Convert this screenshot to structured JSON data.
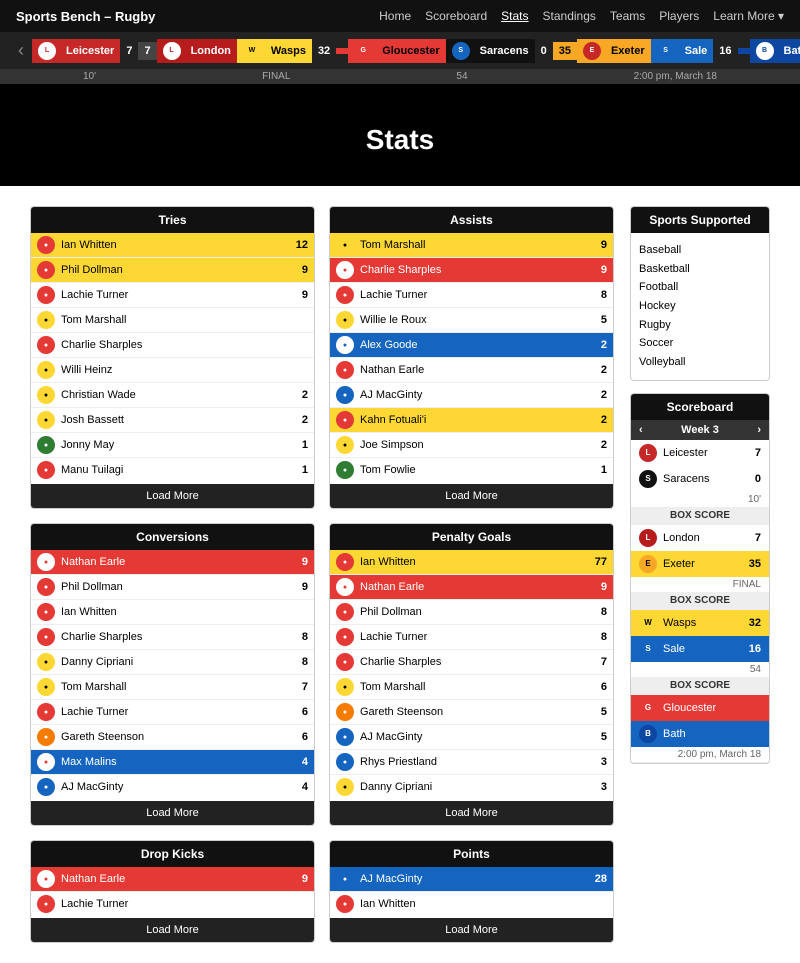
{
  "nav": {
    "title": "Sports Bench – Rugby",
    "links": [
      "Home",
      "Scoreboard",
      "Stats",
      "Standings",
      "Teams",
      "Players",
      "Learn More ▾"
    ]
  },
  "scorebar": {
    "matches": [
      {
        "home": "Leicester",
        "home_score": 7,
        "away": "London",
        "away_score": 7
      },
      {
        "home": "Wasps",
        "home_score": 32,
        "away": "Gloucester",
        "away_score": ""
      },
      {
        "home": "Saracens",
        "home_score": 0,
        "away": "Exeter",
        "away_score": 35
      },
      {
        "home": "Sale",
        "home_score": 16,
        "away": "Bath",
        "away_score": ""
      }
    ],
    "times": [
      "10'",
      "FINAL",
      "54",
      "2:00 pm, March 18"
    ]
  },
  "hero": {
    "title": "Stats"
  },
  "sports_supported": {
    "title": "Sports Supported",
    "sports": [
      "Baseball",
      "Basketball",
      "Football",
      "Hockey",
      "Rugby",
      "Soccer",
      "Volleyball"
    ]
  },
  "scoreboard": {
    "title": "Scoreboard",
    "week": "Week 3",
    "matches": [
      {
        "home": "Leicester",
        "home_score": 7,
        "home_color": "leicester-red",
        "away": "Saracens",
        "away_score": 0,
        "away_color": "saracens-black",
        "time": "10'",
        "box_score": "BOX SCORE"
      },
      {
        "home": "London",
        "home_score": 7,
        "home_color": "london-red2",
        "away": "Exeter",
        "away_score": 35,
        "away_color": "exeter-yellow",
        "time": "FINAL",
        "box_score": "BOX SCORE"
      },
      {
        "home": "Wasps",
        "home_score": 32,
        "home_color": "wasps-yellow",
        "away": "Sale",
        "away_score": 16,
        "away_color": "sale-blue",
        "time": "54",
        "box_score": "BOX SCORE"
      },
      {
        "home": "Gloucester",
        "home_score": "",
        "home_color": "gloucester-red",
        "away": "Bath",
        "away_score": "",
        "away_color": "bath-blue2",
        "time": "2:00 pm, March 18",
        "box_score": ""
      }
    ]
  },
  "tries": {
    "title": "Tries",
    "rows": [
      {
        "name": "Ian Whitten",
        "val": 12,
        "color": "badge-red",
        "bg": "highlight-yellow"
      },
      {
        "name": "Phil Dollman",
        "val": 9,
        "color": "badge-red",
        "bg": "highlight-yellow"
      },
      {
        "name": "Lachie Turner",
        "val": 9,
        "color": "badge-red",
        "bg": ""
      },
      {
        "name": "Tom Marshall",
        "val": "",
        "color": "badge-yellow",
        "bg": ""
      },
      {
        "name": "Charlie Sharples",
        "val": "",
        "color": "badge-red",
        "bg": ""
      },
      {
        "name": "Willi Heinz",
        "val": "",
        "color": "badge-yellow",
        "bg": ""
      },
      {
        "name": "Christian Wade",
        "val": 2,
        "color": "badge-yellow",
        "bg": ""
      },
      {
        "name": "Josh Bassett",
        "val": 2,
        "color": "badge-yellow",
        "bg": ""
      },
      {
        "name": "Jonny May",
        "val": 1,
        "color": "badge-green",
        "bg": ""
      },
      {
        "name": "Manu Tuilagi",
        "val": 1,
        "color": "badge-red",
        "bg": ""
      }
    ],
    "load_more": "Load More"
  },
  "assists": {
    "title": "Assists",
    "rows": [
      {
        "name": "Tom Marshall",
        "val": 9,
        "color": "badge-yellow",
        "bg": "highlight-yellow"
      },
      {
        "name": "Charlie Sharples",
        "val": 9,
        "color": "badge-red",
        "bg": "highlight-red"
      },
      {
        "name": "Lachie Turner",
        "val": 8,
        "color": "badge-red",
        "bg": ""
      },
      {
        "name": "Willie le Roux",
        "val": 5,
        "color": "badge-yellow",
        "bg": ""
      },
      {
        "name": "Alex Goode",
        "val": 2,
        "color": "badge-black",
        "bg": "highlight-blue"
      },
      {
        "name": "Nathan Earle",
        "val": 2,
        "color": "badge-red",
        "bg": ""
      },
      {
        "name": "AJ MacGinty",
        "val": 2,
        "color": "badge-blue",
        "bg": ""
      },
      {
        "name": "Kahn Fotuali'i",
        "val": 2,
        "color": "badge-red",
        "bg": "highlight-yellow"
      },
      {
        "name": "Joe Simpson",
        "val": 2,
        "color": "badge-yellow",
        "bg": ""
      },
      {
        "name": "Tom Fowlie",
        "val": 1,
        "color": "badge-green",
        "bg": ""
      }
    ],
    "load_more": "Load More"
  },
  "conversions": {
    "title": "Conversions",
    "rows": [
      {
        "name": "Nathan Earle",
        "val": 9,
        "color": "badge-red",
        "bg": "highlight-red"
      },
      {
        "name": "Phil Dollman",
        "val": 9,
        "color": "badge-red",
        "bg": ""
      },
      {
        "name": "Ian Whitten",
        "val": "",
        "color": "badge-red",
        "bg": ""
      },
      {
        "name": "Charlie Sharples",
        "val": 8,
        "color": "badge-red",
        "bg": ""
      },
      {
        "name": "Danny Cipriani",
        "val": 8,
        "color": "badge-yellow",
        "bg": ""
      },
      {
        "name": "Tom Marshall",
        "val": 7,
        "color": "badge-yellow",
        "bg": ""
      },
      {
        "name": "Lachie Turner",
        "val": 6,
        "color": "badge-red",
        "bg": ""
      },
      {
        "name": "Gareth Steenson",
        "val": 6,
        "color": "badge-orange",
        "bg": ""
      },
      {
        "name": "Max Malins",
        "val": 4,
        "color": "badge-red",
        "bg": "highlight-blue"
      },
      {
        "name": "AJ MacGinty",
        "val": 4,
        "color": "badge-blue",
        "bg": ""
      }
    ],
    "load_more": "Load More"
  },
  "penalty_goals": {
    "title": "Penalty Goals",
    "rows": [
      {
        "name": "Ian Whitten",
        "val": 77,
        "color": "badge-red",
        "bg": "highlight-yellow"
      },
      {
        "name": "Nathan Earle",
        "val": 9,
        "color": "badge-red",
        "bg": "highlight-red"
      },
      {
        "name": "Phil Dollman",
        "val": 8,
        "color": "badge-red",
        "bg": ""
      },
      {
        "name": "Lachie Turner",
        "val": 8,
        "color": "badge-red",
        "bg": ""
      },
      {
        "name": "Charlie Sharples",
        "val": 7,
        "color": "badge-red",
        "bg": ""
      },
      {
        "name": "Tom Marshall",
        "val": 6,
        "color": "badge-yellow",
        "bg": ""
      },
      {
        "name": "Gareth Steenson",
        "val": 5,
        "color": "badge-orange",
        "bg": ""
      },
      {
        "name": "AJ MacGinty",
        "val": 5,
        "color": "badge-blue",
        "bg": ""
      },
      {
        "name": "Rhys Priestland",
        "val": 3,
        "color": "badge-blue",
        "bg": ""
      },
      {
        "name": "Danny Cipriani",
        "val": 3,
        "color": "badge-yellow",
        "bg": ""
      }
    ],
    "load_more": "Load More"
  },
  "drop_kicks": {
    "title": "Drop Kicks",
    "rows": [
      {
        "name": "Nathan Earle",
        "val": 9,
        "color": "badge-red",
        "bg": "highlight-red"
      },
      {
        "name": "Lachie Turner",
        "val": "",
        "color": "badge-red",
        "bg": ""
      }
    ],
    "load_more": "Load More"
  },
  "points": {
    "title": "Points",
    "rows": [
      {
        "name": "AJ MacGinty",
        "val": 28,
        "color": "badge-blue",
        "bg": "highlight-blue"
      },
      {
        "name": "Ian Whitten",
        "val": "",
        "color": "badge-red",
        "bg": ""
      }
    ],
    "load_more": "Load More"
  }
}
